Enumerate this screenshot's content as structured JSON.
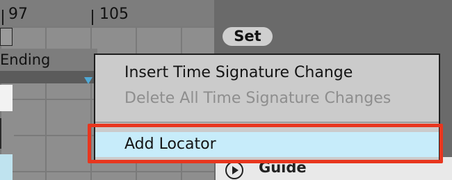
{
  "ruler": {
    "markers": [
      "97",
      "105"
    ]
  },
  "arrangement": {
    "locator_label": "Ending",
    "set_button_label": "Set"
  },
  "context_menu": {
    "items": [
      {
        "label": "Insert Time Signature Change",
        "enabled": true
      },
      {
        "label": "Delete All Time Signature Changes",
        "enabled": false
      },
      {
        "label": "Add Locator",
        "enabled": true,
        "selected": true
      }
    ]
  },
  "guide_button": {
    "label": "Guide",
    "icon": "play-circle-icon"
  },
  "colors": {
    "menu_background": "#cbcbcb",
    "selected_item": "#c7ecfa",
    "highlight_box": "#e8361e",
    "locator_marker": "#4fa9d6"
  }
}
